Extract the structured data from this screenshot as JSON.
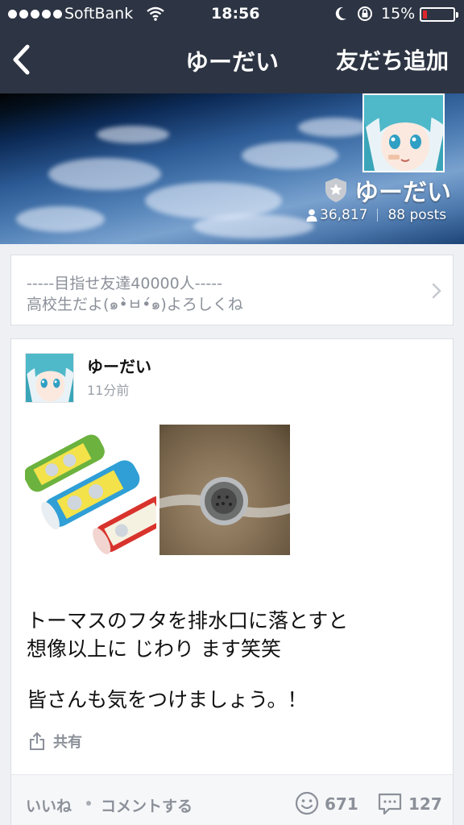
{
  "status_bar": {
    "carrier": "SoftBank",
    "time": "18:56",
    "battery_percent": "15%",
    "battery_level": 0.15,
    "signal_icon": "signal-dots-icon",
    "wifi_icon": "wifi-icon",
    "dnd_icon": "moon-icon",
    "orientation_lock_icon": "orientation-lock-icon",
    "battery_color": "#e0262b"
  },
  "nav": {
    "back_icon": "chevron-left-icon",
    "title": "ゆーだい",
    "add_friend_label": "友だち追加",
    "background": "#2d3443"
  },
  "profile": {
    "name": "ゆーだい",
    "friends_count": "36,817",
    "posts_label": "88 posts",
    "badge_icon": "star-shield-icon",
    "friends_icon": "person-icon"
  },
  "bio": {
    "line1": "-----目指せ友達40000人-----",
    "line2": "高校生だよ(๑•̀ㅂ•́๑)よろしくね"
  },
  "post": {
    "author": "ゆーだい",
    "time": "11分前",
    "text_lines": [
      "トーマスのフタを排水口に落とすと",
      "想像以上に じわり ます笑笑",
      "皆さんも気をつけましょう。！"
    ],
    "share_label": "共有",
    "like_label": "いいね",
    "comment_label": "コメントする",
    "like_count": "671",
    "comment_count": "127"
  }
}
